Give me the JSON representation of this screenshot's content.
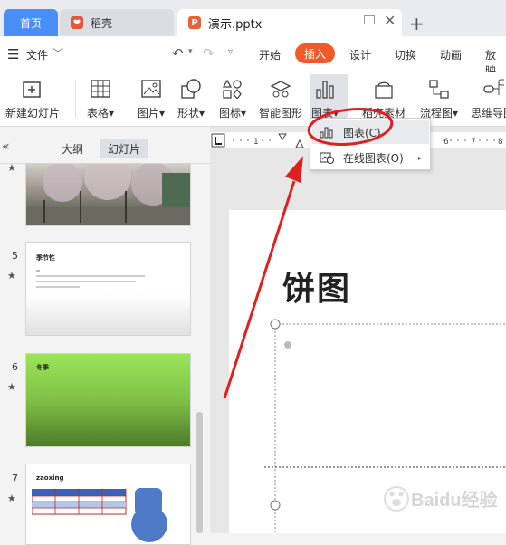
{
  "tabs": {
    "home": "首页",
    "daoke": "稻壳",
    "file": "演示.pptx"
  },
  "menu": {
    "file": "文件",
    "items": [
      "开始",
      "插入",
      "设计",
      "切换",
      "动画",
      "放映"
    ]
  },
  "ribbon": {
    "new_slide": "新建幻灯片",
    "table": "表格",
    "picture": "图片",
    "shape": "形状",
    "icon": "图标",
    "smartart": "智能图形",
    "chart": "图表",
    "daoke_material": "稻壳素材",
    "flowchart": "流程图",
    "mindmap": "思维导图"
  },
  "dropdown": {
    "chart": "图表(C)",
    "online_chart": "在线图表(O)"
  },
  "left_panel": {
    "outline": "大纲",
    "slides": "幻灯片",
    "slide_numbers": [
      "5",
      "6",
      "7"
    ],
    "slide5_title": "季节性",
    "slide6_title": "冬季",
    "slide7_title": "zaoxing"
  },
  "slide": {
    "title": "饼图"
  },
  "watermark": "Baidu经验",
  "colors": {
    "accent_orange": "#f05a2b",
    "home_blue": "#4a8ff6",
    "annotation_red": "#e02020"
  }
}
